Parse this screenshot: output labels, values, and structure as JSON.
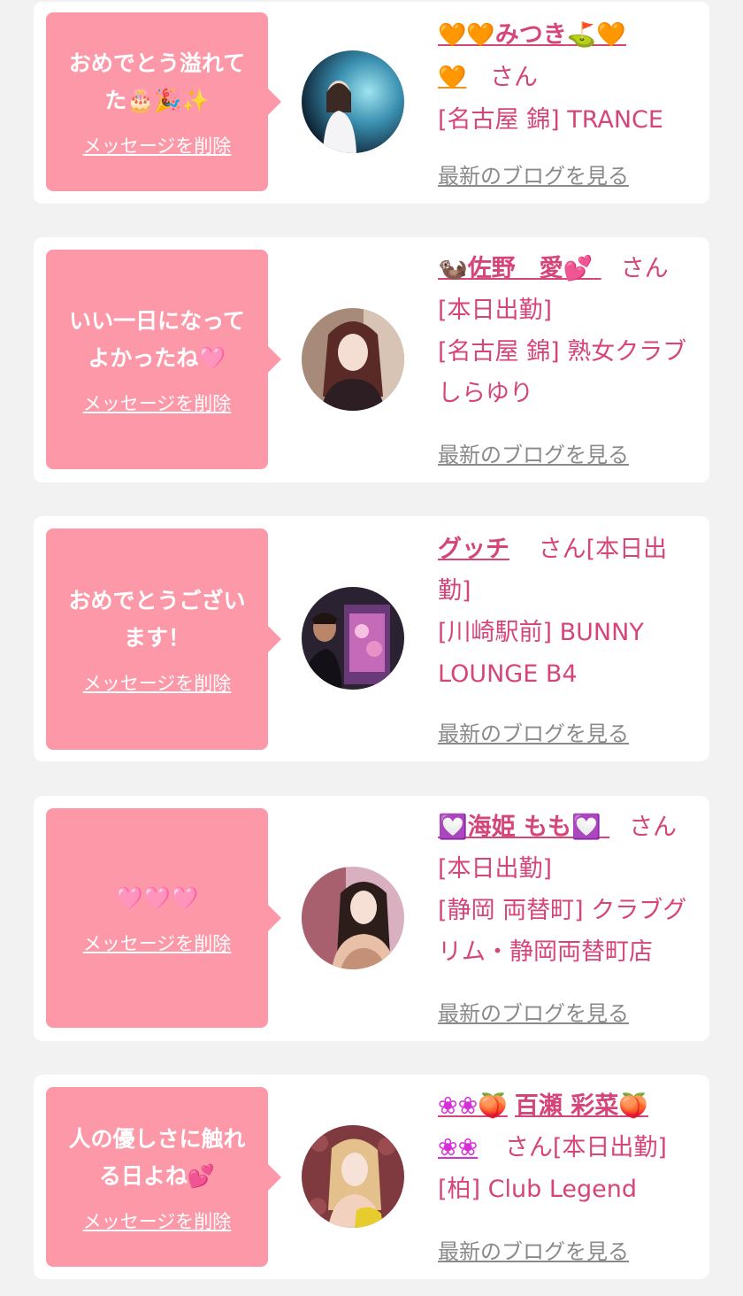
{
  "cards": [
    {
      "message": "おめでとう溢れて\nた🎂🎉✨",
      "delete_label": "メッセージを削除",
      "name": "みつき",
      "name_decor_left": "🧡🧡",
      "name_decor_right": "⛳🧡",
      "name_decor_right2": "🧡",
      "san": "さん",
      "status": "",
      "shop": "[名古屋 錦] TRANCE",
      "blog_label": "最新のブログを見る"
    },
    {
      "message": "いい一日になって\nよかったね🩷",
      "delete_label": "メッセージを削除",
      "name": "佐野　愛",
      "name_decor_left": "🦦",
      "name_decor_right": "💕",
      "san": "さん",
      "status": "[本日出勤]",
      "shop": "[名古屋 錦] 熟女クラブ\nしらゆり",
      "blog_label": "最新のブログを見る"
    },
    {
      "message": "おめでとうござい\nます！",
      "delete_label": "メッセージを削除",
      "name": "グッチ",
      "san": "さん[本日出",
      "status": "勤]",
      "shop": "[川崎駅前] BUNNY\nLOUNGE B4",
      "blog_label": "最新のブログを見る"
    },
    {
      "message": "🩷🩷🩷",
      "delete_label": "メッセージを削除",
      "name": "海姫 もも",
      "name_decor_left": "💟",
      "name_decor_right": "💟",
      "san": "さん",
      "status": "[本日出勤]",
      "shop": "[静岡 両替町] クラブグ\nリム・静岡両替町店",
      "blog_label": "最新のブログを見る"
    },
    {
      "message": "人の優しさに触れ\nる日よね💕",
      "delete_label": "メッセージを削除",
      "name": "百瀬 彩菜",
      "name_decor_left": "❀❀🍑",
      "name_decor_right": "🍑",
      "name_decor_right2": "❀❀",
      "san": "さん[本日出勤]",
      "status": "",
      "shop": "[柏] Club Legend",
      "blog_label": "最新のブログを見る"
    }
  ],
  "colors": {
    "bubble": "#fd98a8",
    "accent": "#d6457a",
    "background": "#f2f2f2",
    "link_gray": "#8a8a8a"
  }
}
